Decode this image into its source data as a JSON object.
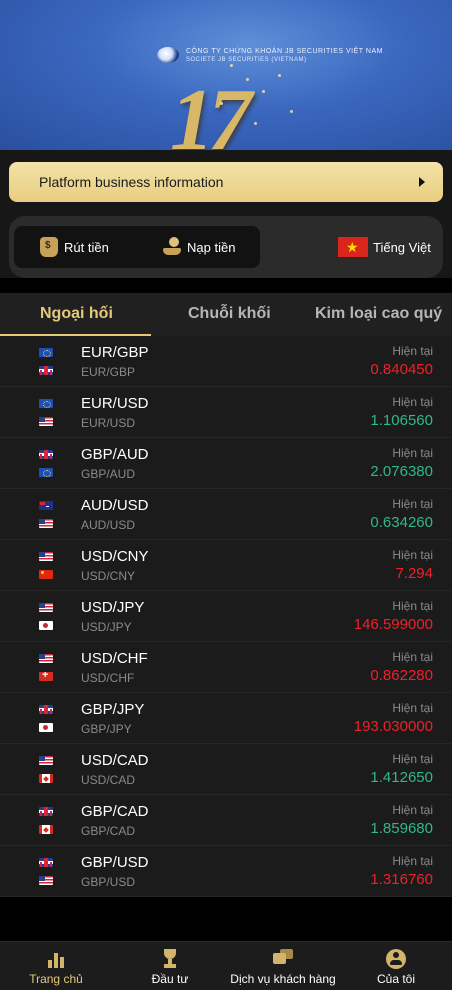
{
  "banner": {
    "logo_line1": "CÔNG TY CHỨNG KHOÁN JB SECURITIES VIỆT NAM",
    "logo_line2": "SOCIETE JB SECURITIES (VIETNAM)",
    "anniversary": "17"
  },
  "business_bar": {
    "label": "Platform business information"
  },
  "actions": {
    "withdraw_label": "Rút tiền",
    "deposit_label": "Nạp tiền",
    "language_label": "Tiếng Việt"
  },
  "tabs": [
    {
      "label": "Ngoại hối",
      "active": true
    },
    {
      "label": "Chuỗi khối",
      "active": false
    },
    {
      "label": "Kim loại cao quý",
      "active": false
    }
  ],
  "price_label": "Hiện tại",
  "pairs": [
    {
      "pair": "EUR/GBP",
      "sub": "EUR/GBP",
      "flags": [
        "eu",
        "gb"
      ],
      "price": "0.840450",
      "direction": "down"
    },
    {
      "pair": "EUR/USD",
      "sub": "EUR/USD",
      "flags": [
        "eu",
        "us"
      ],
      "price": "1.106560",
      "direction": "up"
    },
    {
      "pair": "GBP/AUD",
      "sub": "GBP/AUD",
      "flags": [
        "gb",
        "eu"
      ],
      "price": "2.076380",
      "direction": "up"
    },
    {
      "pair": "AUD/USD",
      "sub": "AUD/USD",
      "flags": [
        "au",
        "us"
      ],
      "price": "0.634260",
      "direction": "up"
    },
    {
      "pair": "USD/CNY",
      "sub": "USD/CNY",
      "flags": [
        "us",
        "cn"
      ],
      "price": "7.294",
      "direction": "down"
    },
    {
      "pair": "USD/JPY",
      "sub": "USD/JPY",
      "flags": [
        "us",
        "jp"
      ],
      "price": "146.599000",
      "direction": "down"
    },
    {
      "pair": "USD/CHF",
      "sub": "USD/CHF",
      "flags": [
        "us",
        "ch"
      ],
      "price": "0.862280",
      "direction": "down"
    },
    {
      "pair": "GBP/JPY",
      "sub": "GBP/JPY",
      "flags": [
        "gb",
        "jp"
      ],
      "price": "193.030000",
      "direction": "down"
    },
    {
      "pair": "USD/CAD",
      "sub": "USD/CAD",
      "flags": [
        "us",
        "ca"
      ],
      "price": "1.412650",
      "direction": "up"
    },
    {
      "pair": "GBP/CAD",
      "sub": "GBP/CAD",
      "flags": [
        "gb",
        "ca"
      ],
      "price": "1.859680",
      "direction": "up"
    },
    {
      "pair": "GBP/USD",
      "sub": "GBP/USD",
      "flags": [
        "gb",
        "us"
      ],
      "price": "1.316760",
      "direction": "down"
    }
  ],
  "bottom_nav": [
    {
      "label": "Trang chủ",
      "icon": "bar-chart-icon",
      "active": true
    },
    {
      "label": "Đầu tư",
      "icon": "trophy-icon",
      "active": false
    },
    {
      "label": "Dịch vụ khách hàng",
      "icon": "chat-icon",
      "active": false
    },
    {
      "label": "Của tôi",
      "icon": "user-icon",
      "active": false
    }
  ],
  "colors": {
    "accent": "#e5c978",
    "up": "#2fb985",
    "down": "#f0202a"
  }
}
